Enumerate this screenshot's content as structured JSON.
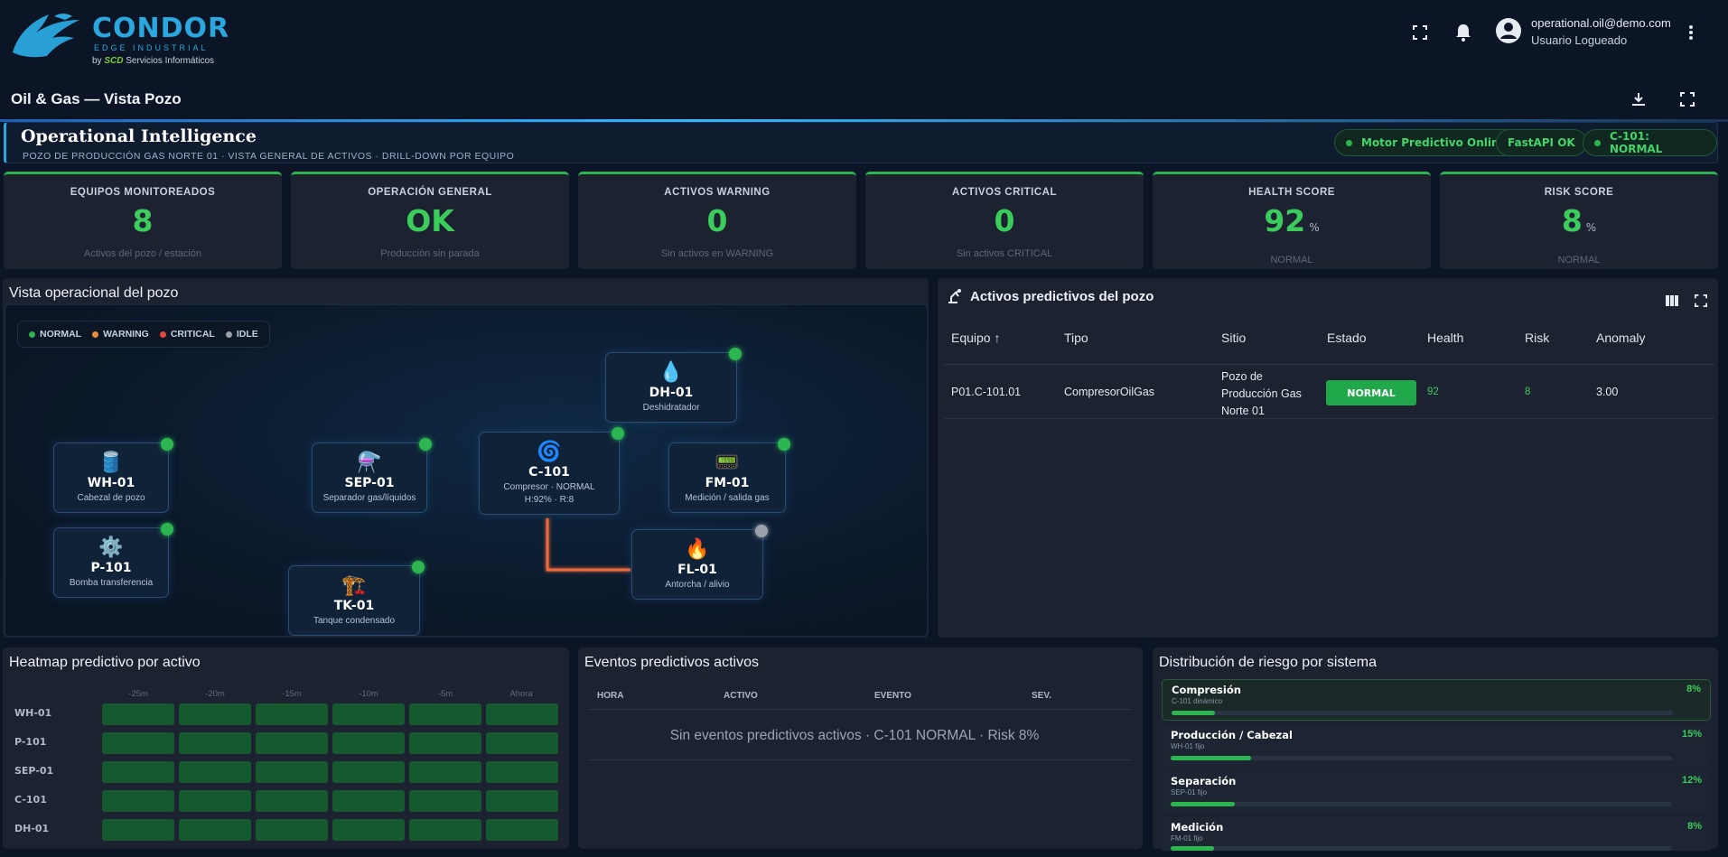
{
  "brand": {
    "name": "CONDOR",
    "tagline": "EDGE INDUSTRIAL",
    "by": "by",
    "company_short": "SCD",
    "company_rest": "Servicios Informáticos"
  },
  "user": {
    "email": "operational.oil@demo.com",
    "role": "Usuario Logueado"
  },
  "page": {
    "title": "Oil & Gas — Vista Pozo"
  },
  "header": {
    "title": "Operational Intelligence",
    "subtitle": "POZO DE PRODUCCIÓN GAS NORTE 01 · VISTA GENERAL DE ACTIVOS · DRILL-DOWN POR EQUIPO",
    "pills": [
      "Motor Predictivo Online",
      "FastAPI OK",
      "C-101: NORMAL"
    ]
  },
  "kpis": [
    {
      "label": "EQUIPOS MONITOREADOS",
      "value": "8",
      "unit": "",
      "sub": "Activos del pozo / estación"
    },
    {
      "label": "OPERACIÓN GENERAL",
      "value": "OK",
      "unit": "",
      "sub": "Producción sin parada"
    },
    {
      "label": "ACTIVOS WARNING",
      "value": "0",
      "unit": "",
      "sub": "Sin activos en WARNING"
    },
    {
      "label": "ACTIVOS CRITICAL",
      "value": "0",
      "unit": "",
      "sub": "Sin activos CRITICAL"
    },
    {
      "label": "HEALTH SCORE",
      "value": "92",
      "unit": "%",
      "sub": "NORMAL"
    },
    {
      "label": "RISK SCORE",
      "value": "8",
      "unit": "%",
      "sub": "NORMAL"
    }
  ],
  "well_view": {
    "title": "Vista operacional del pozo",
    "legend": [
      {
        "label": "NORMAL",
        "color": "#2db552"
      },
      {
        "label": "WARNING",
        "color": "#f08a3c"
      },
      {
        "label": "CRITICAL",
        "color": "#e5483f"
      },
      {
        "label": "IDLE",
        "color": "#9aa1ab"
      }
    ],
    "nodes": [
      {
        "id": "WH-01",
        "desc": "Cabezal de pozo",
        "meta": "",
        "icon": "🛢️",
        "status": "normal"
      },
      {
        "id": "SEP-01",
        "desc": "Separador gas/líquidos",
        "meta": "",
        "icon": "⚗️",
        "status": "normal"
      },
      {
        "id": "C-101",
        "desc": "Compresor · NORMAL",
        "meta": "H:92% · R:8",
        "icon": "🌀",
        "status": "normal"
      },
      {
        "id": "DH-01",
        "desc": "Deshidratador",
        "meta": "",
        "icon": "💧",
        "status": "normal"
      },
      {
        "id": "FM-01",
        "desc": "Medición / salida gas",
        "meta": "",
        "icon": "📟",
        "status": "normal"
      },
      {
        "id": "P-101",
        "desc": "Bomba transferencia",
        "meta": "",
        "icon": "⚙️",
        "status": "normal"
      },
      {
        "id": "TK-01",
        "desc": "Tanque condensado",
        "meta": "",
        "icon": "🏗️",
        "status": "normal"
      },
      {
        "id": "FL-01",
        "desc": "Antorcha / alivio",
        "meta": "",
        "icon": "🔥",
        "status": "idle"
      }
    ]
  },
  "assets": {
    "title": "Activos predictivos del pozo",
    "columns": [
      "Equipo",
      "Tipo",
      "Sitio",
      "Estado",
      "Health",
      "Risk",
      "Anomaly"
    ],
    "rows": [
      {
        "equipo": "P01.C-101.01",
        "tipo": "CompresorOilGas",
        "sitio": "Pozo de Producción Gas Norte 01",
        "estado": "NORMAL",
        "health": "92",
        "risk": "8",
        "anomaly": "3.00"
      }
    ]
  },
  "heatmap": {
    "title": "Heatmap predictivo por activo",
    "columns": [
      "-25m",
      "-20m",
      "-15m",
      "-10m",
      "-5m",
      "Ahora"
    ],
    "rows": [
      "WH-01",
      "P-101",
      "SEP-01",
      "C-101",
      "DH-01"
    ],
    "cell_color": "#155a2e"
  },
  "events": {
    "title": "Eventos predictivos activos",
    "columns": [
      "HORA",
      "ACTIVO",
      "EVENTO",
      "SEV."
    ],
    "empty": "Sin eventos predictivos activos · C-101 NORMAL · Risk 8%"
  },
  "risk": {
    "title": "Distribución de riesgo por sistema",
    "items": [
      {
        "name": "Compresión",
        "sub": "C-101 dinámico",
        "value": "8%",
        "pct": 8
      },
      {
        "name": "Producción / Cabezal",
        "sub": "WH-01 fijo",
        "value": "15%",
        "pct": 15
      },
      {
        "name": "Separación",
        "sub": "SEP-01 fijo",
        "value": "12%",
        "pct": 12
      },
      {
        "name": "Medición",
        "sub": "FM-01 fijo",
        "value": "8%",
        "pct": 8
      }
    ]
  },
  "colors": {
    "accent": "#2aa7de",
    "normal": "#2db552",
    "bg": "#0b1526",
    "panel": "#1c2230"
  }
}
